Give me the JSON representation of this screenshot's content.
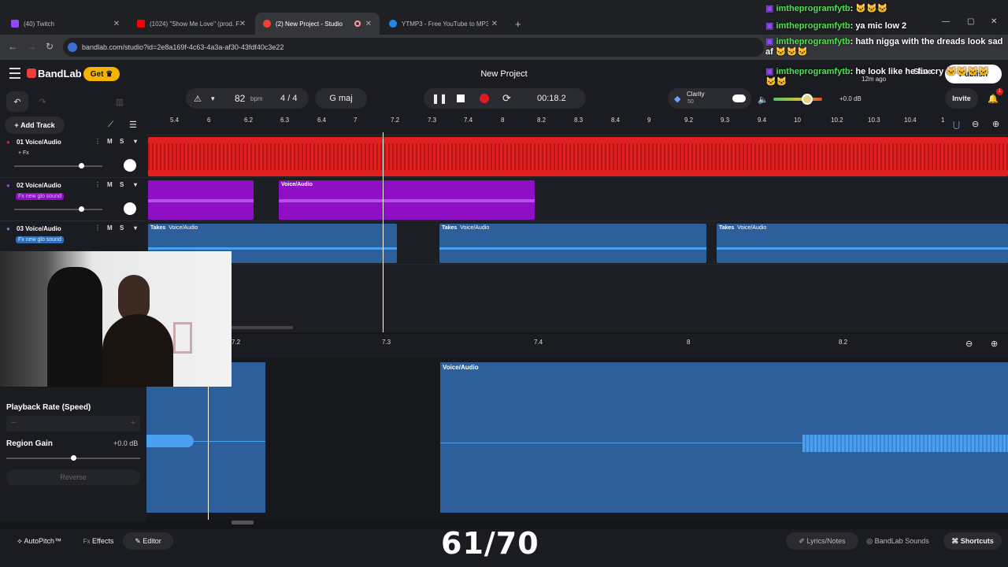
{
  "browser": {
    "tabs": [
      {
        "label": "(40) Twitch",
        "color": "#9146ff"
      },
      {
        "label": "(1024) \"Show Me Love\" (prod. F",
        "color": "#ff0000"
      },
      {
        "label": "(2) New Project - Studio",
        "color": "#f44336"
      },
      {
        "label": "YTMP3 - Free YouTube to MP3",
        "color": "#1e88e5"
      }
    ],
    "new_tab": "+",
    "url": "bandlab.com/studio?id=2e8a169f-4c63-4a3a-af30-43fdf40c3e22",
    "window_controls": [
      "—",
      "▢",
      "✕"
    ]
  },
  "app": {
    "brand": "BandLab",
    "get_label": "Get",
    "project_title": "New Project",
    "save_label": "Save",
    "publish_label": "Publish",
    "saved_ago": "12m ago",
    "invite_label": "Invite",
    "notif_count": "1"
  },
  "toolbar": {
    "tempo": "82",
    "bpm_label": "bpm",
    "time_sig_num": "4",
    "time_sig_sep": "/",
    "time_sig_den": "4",
    "key": "G maj",
    "time": "00:18.2",
    "clarity_label": "Clarity",
    "clarity_value": "50",
    "master_gain": "+0.0 dB",
    "add_track": "Add Track"
  },
  "ruler": {
    "ticks": [
      "5.4",
      "6",
      "6.2",
      "6.3",
      "6.4",
      "7",
      "7.2",
      "7.3",
      "7.4",
      "8",
      "8.2",
      "8.3",
      "8.4",
      "9",
      "9.2",
      "9.3",
      "9.4",
      "10",
      "10.2",
      "10.3",
      "10.4",
      "1"
    ]
  },
  "tracks": [
    {
      "num": "01",
      "name": "Voice/Audio",
      "fx": "+ Fx",
      "color": "#e02020"
    },
    {
      "num": "02",
      "name": "Voice/Audio",
      "fx": "Fx new glo sound",
      "color": "#8e0fc4"
    },
    {
      "num": "03",
      "name": "Voice/Audio",
      "fx": "Fx new glo sound",
      "color": "#2f6fb3"
    }
  ],
  "regions": {
    "voice_label": "Voice/Audio",
    "takes_label": "Takes"
  },
  "editor": {
    "ticks": [
      "7.2",
      "7.3",
      "7.4",
      "8",
      "8.2"
    ],
    "region_label": "Voice/Audio",
    "playback_rate_label": "Playback Rate (Speed)",
    "region_gain_label": "Region Gain",
    "region_gain_value": "+0.0 dB",
    "reverse_label": "Reverse"
  },
  "bottom": {
    "autopitch": "AutoPitch™",
    "effects_prefix": "Fx",
    "effects": "Effects",
    "editor": "Editor",
    "lyrics": "Lyrics/Notes",
    "sounds": "BandLab Sounds",
    "shortcuts": "Shortcuts",
    "counter": "61/70"
  },
  "chat": [
    {
      "user": "imtheprogramfytb",
      "msg": ": 🐱🐱🐱"
    },
    {
      "user": "imtheprogramfytb",
      "msg": ": ya mic low 2"
    },
    {
      "user": "imtheprogramfytb",
      "msg": ": hath nigga with the dreads look sad af 🐱🐱🐱"
    },
    {
      "user": "imtheprogramfytb",
      "msg": ": he look like he fin cry 🐱🐱🐱🐱 🐱🐱"
    }
  ]
}
